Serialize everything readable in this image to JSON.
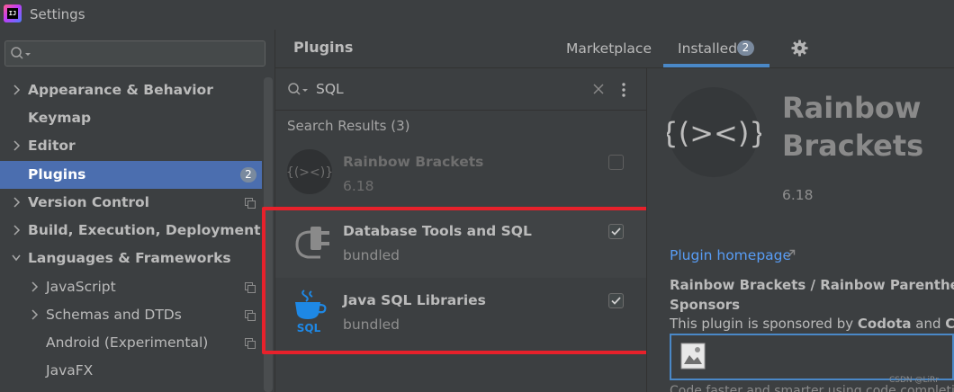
{
  "window": {
    "title": "Settings",
    "logo_text": "IJ"
  },
  "left": {
    "search_placeholder": "",
    "tree": [
      {
        "label": "Appearance & Behavior",
        "bold": true,
        "arrow": "right",
        "indent": 0
      },
      {
        "label": "Keymap",
        "bold": true,
        "arrow": "none",
        "indent": 0
      },
      {
        "label": "Editor",
        "bold": true,
        "arrow": "right",
        "indent": 0
      },
      {
        "label": "Plugins",
        "bold": true,
        "arrow": "none",
        "indent": 0,
        "selected": true,
        "badge": "2"
      },
      {
        "label": "Version Control",
        "bold": true,
        "arrow": "right",
        "indent": 0,
        "project_icon": true
      },
      {
        "label": "Build, Execution, Deployment",
        "bold": true,
        "arrow": "right",
        "indent": 0
      },
      {
        "label": "Languages & Frameworks",
        "bold": true,
        "arrow": "down",
        "indent": 0
      },
      {
        "label": "JavaScript",
        "bold": false,
        "arrow": "right",
        "indent": 1,
        "project_icon": true
      },
      {
        "label": "Schemas and DTDs",
        "bold": false,
        "arrow": "right",
        "indent": 1,
        "project_icon": true
      },
      {
        "label": "Android (Experimental)",
        "bold": false,
        "arrow": "none",
        "indent": 1,
        "project_icon": true
      },
      {
        "label": "JavaFX",
        "bold": false,
        "arrow": "none",
        "indent": 1
      }
    ]
  },
  "header": {
    "title": "Plugins",
    "tabs": {
      "marketplace": "Marketplace",
      "installed": "Installed",
      "installed_count": "2"
    }
  },
  "list": {
    "search_value": "SQL",
    "results_label": "Search Results (3)",
    "plugins": [
      {
        "name": "Rainbow Brackets",
        "version": "6.18",
        "checked": false
      },
      {
        "name": "Database Tools and SQL",
        "version": "bundled",
        "checked": true
      },
      {
        "name": "Java SQL Libraries",
        "version": "bundled",
        "checked": true
      }
    ],
    "java_sql_icon_text": "SQL",
    "rainbow_icon_text": "{(><)}"
  },
  "detail": {
    "logo_text": "{(><)}",
    "name_line1": "Rainbow",
    "name_line2": "Brackets",
    "version": "6.18",
    "homepage_link": "Plugin homepage",
    "description_title": "Rainbow Brackets / Rainbow Parentheses f",
    "sponsors_title": "Sponsors",
    "sponsor_text_prefix": "This plugin is sponsored by ",
    "sponsor_name": "Codota",
    "sponsor_text_mid": " and ",
    "sponsor_name_2": "Coo",
    "cutoff_text": "Code faster and smarter using code completions"
  },
  "watermark": "CSDN @LiRr",
  "colors": {
    "accent": "#4a88c7",
    "selection": "#4b6eaf",
    "highlight": "#e7212b",
    "link": "#589df6"
  }
}
